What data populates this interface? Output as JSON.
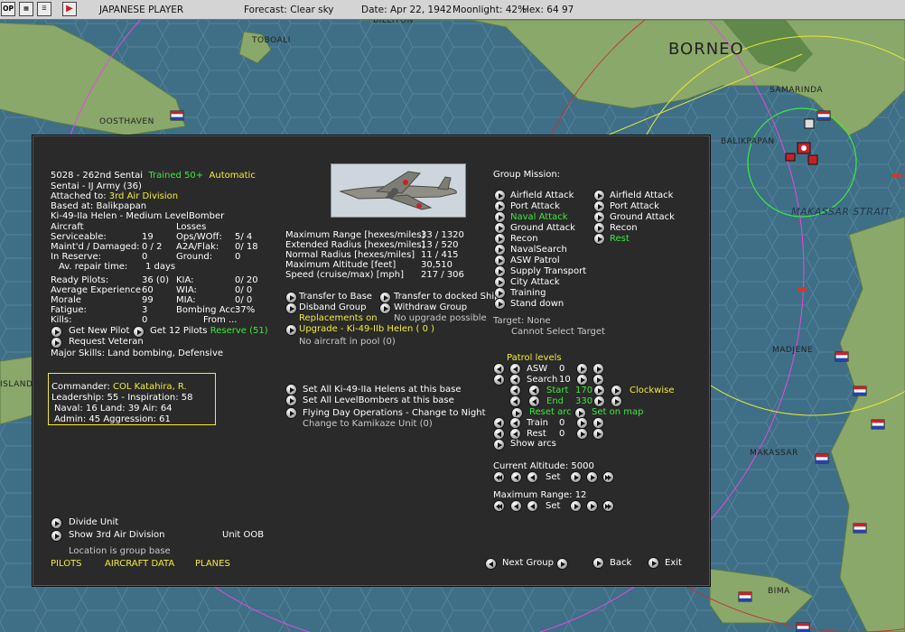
{
  "topbar": {
    "side": "JAPANESE PLAYER",
    "forecast": "Forecast: Clear sky",
    "date": "Date: Apr 22, 1942",
    "moonlight": "Moonlight: 42%",
    "hex": "Hex: 64 97",
    "btn_op": "OP"
  },
  "map": {
    "labels": {
      "borneo": "BORNEO",
      "toboali": "TOBOALI",
      "billiton": "BILLITON",
      "oosthaven": "OOSTHAVEN",
      "samarinda": "SAMARINDA",
      "balikpapan": "BALIKPAPAN",
      "makassar_strait": "MAKASSAR STRAIT",
      "madjene": "MADJENE",
      "makassar": "MAKASSAR",
      "bima": "BIMA",
      "island": "ISLAND"
    }
  },
  "unit": {
    "id_line": "5028 - 262nd Sentai",
    "trained": "Trained 50+",
    "automatic": "Automatic",
    "type": "Sentai - IJ Army (36)",
    "attached_label": "Attached to:",
    "attached_value": "3rd Air Division",
    "based": "Based at: Balikpapan",
    "aircraft": "Ki-49-IIa Helen - Medium LevelBomber"
  },
  "stats": {
    "aircraft_header": "Aircraft",
    "losses_header": "Losses",
    "rows": [
      {
        "label": "Serviceable:",
        "value": "19",
        "l_label": "Ops/WOff:",
        "l_value": "5/ 4"
      },
      {
        "label": "Maint'd / Damaged:",
        "value": "0 / 2",
        "l_label": "A2A/Flak:",
        "l_value": "0/ 18"
      },
      {
        "label": "In Reserve:",
        "value": "0",
        "l_label": "Ground:",
        "l_value": "0"
      }
    ],
    "repair_label": "Av. repair time:",
    "repair_value": "1 days",
    "rows2": [
      {
        "label": "Ready Pilots:",
        "value": "36 (0)",
        "l_label": "KIA:",
        "l_value": "0/ 20"
      },
      {
        "label": "Average Experience",
        "value": "60",
        "l_label": "WIA:",
        "l_value": "0/ 0"
      },
      {
        "label": "Morale",
        "value": "99",
        "l_label": "MIA:",
        "l_value": "0/ 0"
      },
      {
        "label": "Fatigue:",
        "value": "3",
        "l_label": "Bombing Acc:",
        "l_value": "37%"
      },
      {
        "label": "Kills:",
        "value": "0",
        "l_label": "From ...",
        "l_value": ""
      }
    ]
  },
  "pilot_actions": {
    "get_new": "Get New Pilot",
    "get_12": "Get 12 Pilots",
    "reserve": "Reserve (51)",
    "request_veteran": "Request Veteran",
    "major_skills": "Major Skills: Land bombing, Defensive"
  },
  "commander": {
    "label": "Commander:",
    "name": "COL Katahira, R.",
    "leadership": "Leadership: 55 - Inspiration: 58",
    "naval": "Naval:  16  Land:  39  Air:  64",
    "admin": "Admin:  45  Aggression:  61"
  },
  "bottom_left": {
    "divide": "Divide Unit",
    "show_div": "Show 3rd Air Division",
    "unit_oob": "Unit OOB",
    "location": "Location is group base",
    "tabs": [
      "PILOTS",
      "AIRCRAFT DATA",
      "PLANES"
    ]
  },
  "ranges": [
    {
      "label": "Maximum Range [hexes/miles]",
      "value": "33 / 1320"
    },
    {
      "label": "Extended Radius [hexes/miles]",
      "value": "13 / 520"
    },
    {
      "label": "Normal Radius [hexes/miles]",
      "value": "11 / 415"
    },
    {
      "label": "Maximum Altitude [feet]",
      "value": "30,510"
    },
    {
      "label": "Speed (cruise/max) [mph]",
      "value": "217 / 306"
    }
  ],
  "group_actions": {
    "transfer_base": "Transfer to Base",
    "transfer_ship": "Transfer to docked Ship",
    "disband": "Disband Group",
    "withdraw": "Withdraw Group",
    "replacements": "Replacements on",
    "no_upgrade": "No upgrade possible",
    "upgrade": "Upgrade - Ki-49-IIb Helen  ( 0 )",
    "no_pool": "No aircraft in pool (0)",
    "set_all_type": "Set All Ki-49-IIa Helens at this base",
    "set_all_role": "Set All LevelBombers at this base",
    "flying": "Flying Day Operations - Change to Night",
    "kamikaze": "Change to Kamikaze Unit (0)"
  },
  "mission": {
    "header": "Group Mission:",
    "primary": [
      "Airfield Attack",
      "Port Attack",
      "Naval Attack",
      "Ground Attack",
      "Recon",
      "NavalSearch",
      "ASW Patrol",
      "Supply Transport",
      "City Attack",
      "Training",
      "Stand down"
    ],
    "secondary": [
      "Airfield Attack",
      "Port Attack",
      "Ground Attack",
      "Recon",
      "Rest"
    ],
    "target": "Target: None",
    "cannot_select": "Cannot Select Target"
  },
  "patrol": {
    "header": "Patrol levels",
    "asw_label": "ASW",
    "asw_value": "0",
    "search_label": "Search",
    "search_value": "10",
    "start_label": "Start",
    "start_value": "170",
    "end_label": "End",
    "end_value": "330",
    "clockwise": "Clockwise",
    "reset_arc": "Reset arc",
    "set_on_map": "Set on map",
    "train_label": "Train",
    "train_value": "0",
    "rest_label": "Rest",
    "rest_value": "0",
    "show_arcs": "Show arcs"
  },
  "altitude": {
    "label": "Current Altitude: 5000",
    "set": "Set"
  },
  "max_range": {
    "label": "Maximum Range: 12",
    "set": "Set"
  },
  "nav": {
    "next_group": "Next Group",
    "back": "Back",
    "exit": "Exit"
  },
  "colors": {
    "yellow": "#f2ee34",
    "green": "#3fe83f",
    "panel": "#2a2a2a",
    "sea": "#3e6f86",
    "land": "#8aa86a"
  }
}
